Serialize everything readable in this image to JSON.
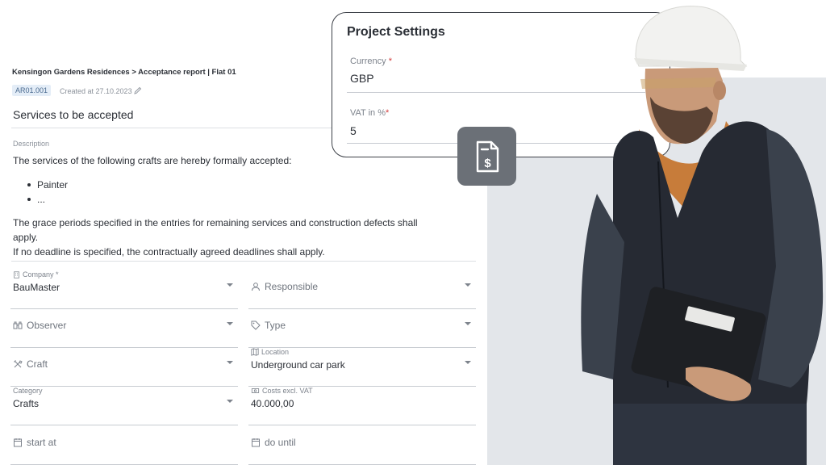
{
  "report": {
    "breadcrumb": "Kensingon Gardens Residences > Acceptance report | Flat 01",
    "id_tag": "AR01.001",
    "created": "Created at 27.10.2023",
    "section_title": "Services to be accepted",
    "description_label": "Description",
    "description_intro": "The services of the following crafts are hereby formally accepted:",
    "bullets": [
      "Painter",
      "..."
    ],
    "description_p2_line1": "The grace periods specified in the entries for remaining services and construction defects shall",
    "description_p2_line2": "apply.",
    "description_p3": "If no deadline is specified, the contractually agreed deadlines shall apply."
  },
  "fields": {
    "company": {
      "label": "Company *",
      "value": "BauMaster",
      "icon": "building-icon"
    },
    "responsible": {
      "placeholder": "Responsible",
      "icon": "person-icon"
    },
    "observer": {
      "placeholder": "Observer",
      "icon": "binoculars-icon"
    },
    "type": {
      "placeholder": "Type",
      "icon": "tag-icon"
    },
    "craft": {
      "placeholder": "Craft",
      "icon": "tools-icon"
    },
    "location": {
      "label": "Location",
      "value": "Underground car park",
      "icon": "map-icon"
    },
    "category": {
      "label": "Category",
      "value": "Crafts"
    },
    "costs": {
      "label": "Costs excl. VAT",
      "value": "40.000,00",
      "icon": "cash-icon"
    },
    "start": {
      "placeholder": "start at",
      "icon": "calendar-icon"
    },
    "until": {
      "placeholder": "do until",
      "icon": "calendar-icon"
    }
  },
  "settings": {
    "title": "Project Settings",
    "currency_label": "Currency",
    "currency_required": "*",
    "currency_value": "GBP",
    "vat_label": "VAT in %",
    "vat_required": "*",
    "vat_value": "5"
  },
  "badge": {
    "icon": "invoice-dollar-icon"
  },
  "colors": {
    "accent_tag_bg": "#e4edf7",
    "required": "#d23b3b",
    "badge_bg": "#6b7077",
    "backdrop": "#e3e6ea"
  }
}
